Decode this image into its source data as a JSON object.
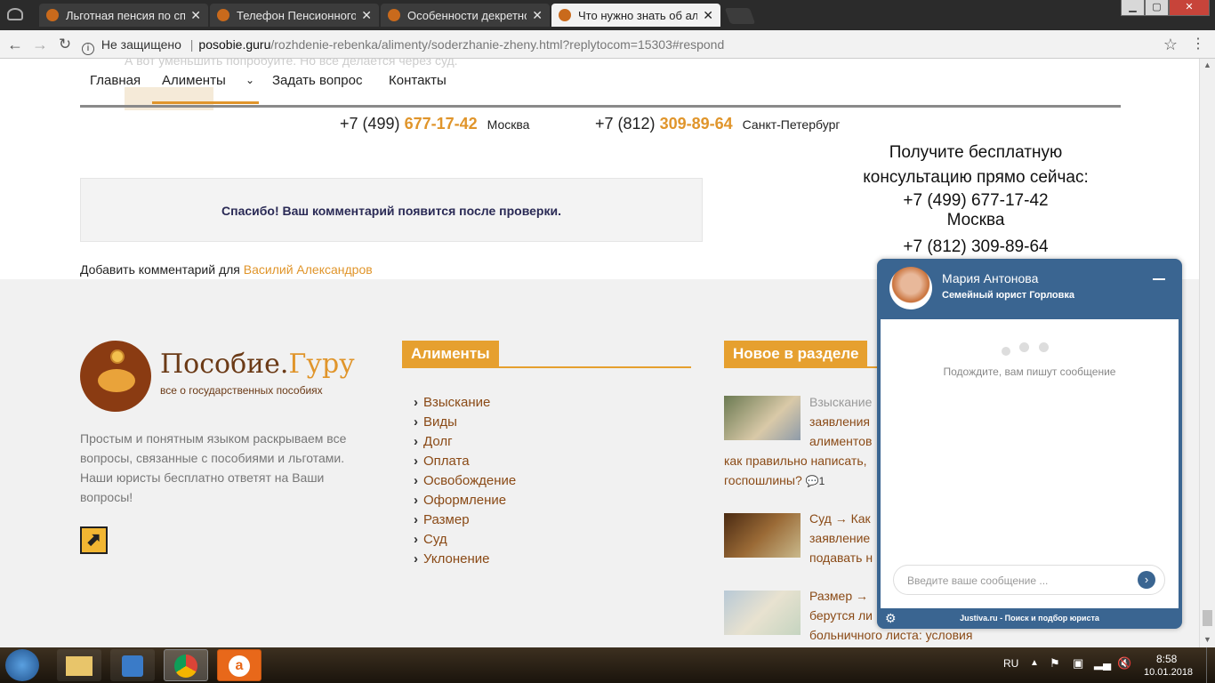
{
  "browser": {
    "tabs": [
      {
        "title": "Льготная пенсия по спи",
        "active": false
      },
      {
        "title": "Телефон Пенсионного ф",
        "active": false
      },
      {
        "title": "Особенности декретног",
        "active": false
      },
      {
        "title": "Что нужно знать об али",
        "active": true
      }
    ],
    "security_label": "Не защищено",
    "url_domain": "posobie.guru",
    "url_path": "/rozhdenie-rebenka/alimenty/soderzhanie-zheny.html?replytocom=15303#respond"
  },
  "site": {
    "faded_text": "А вот уменьшить попробуйте. Но все делается через суд.",
    "menu": [
      "Главная",
      "Алименты",
      "Задать вопрос",
      "Контакты"
    ],
    "phone1_prefix": "+7 (499)",
    "phone1_number": "677-17-42",
    "phone1_city": "Москва",
    "phone2_prefix": "+7 (812)",
    "phone2_number": "309-89-64",
    "phone2_city": "Санкт-Петербург",
    "consult_title": "Получите бесплатную консультацию прямо сейчас:",
    "consult_phone1": "+7 (499) 677-17-42",
    "consult_city1": "Москва",
    "consult_phone2": "+7 (812) 309-89-64",
    "thanks_message": "Спасибо! Ваш комментарий появится после проверки.",
    "add_comment_label": "Добавить комментарий для",
    "add_comment_name": "Василий Александров"
  },
  "footer": {
    "logo_name_1": "Пособие.",
    "logo_name_2": "Гуру",
    "logo_tagline": "все о государственных пособиях",
    "about": "Простым и понятным языком раскрываем все вопросы, связанные с пособиями и льготами. Наши юристы бесплатно ответят на Ваши вопросы!",
    "alimenty_title": "Алименты",
    "alimenty_links": [
      "Взыскание",
      "Виды",
      "Долг",
      "Оплата",
      "Освобождение",
      "Оформление",
      "Размер",
      "Суд",
      "Уклонение"
    ],
    "news_title": "Новое в разделе",
    "news": [
      {
        "lines": [
          "Взыскание",
          "заявления",
          "алиментов",
          "как правильно написать,",
          "госпошлины?"
        ],
        "comments": "1"
      },
      {
        "lines": [
          "Суд → Как",
          "заявление",
          "подавать н"
        ]
      },
      {
        "lines": [
          "Размер →",
          "берутся ли",
          "больничного листа: условия"
        ]
      }
    ]
  },
  "chat": {
    "agent_name": "Мария Антонова",
    "agent_title": "Семейный юрист Горловка",
    "typing_text": "Подождите, вам пишут сообщение",
    "input_placeholder": "Введите ваше сообщение ...",
    "footer_text": "Justiva.ru - Поиск и подбор юриста",
    "accent": "#3a6591"
  },
  "taskbar": {
    "lang": "RU",
    "time": "8:58",
    "date": "10.01.2018"
  }
}
